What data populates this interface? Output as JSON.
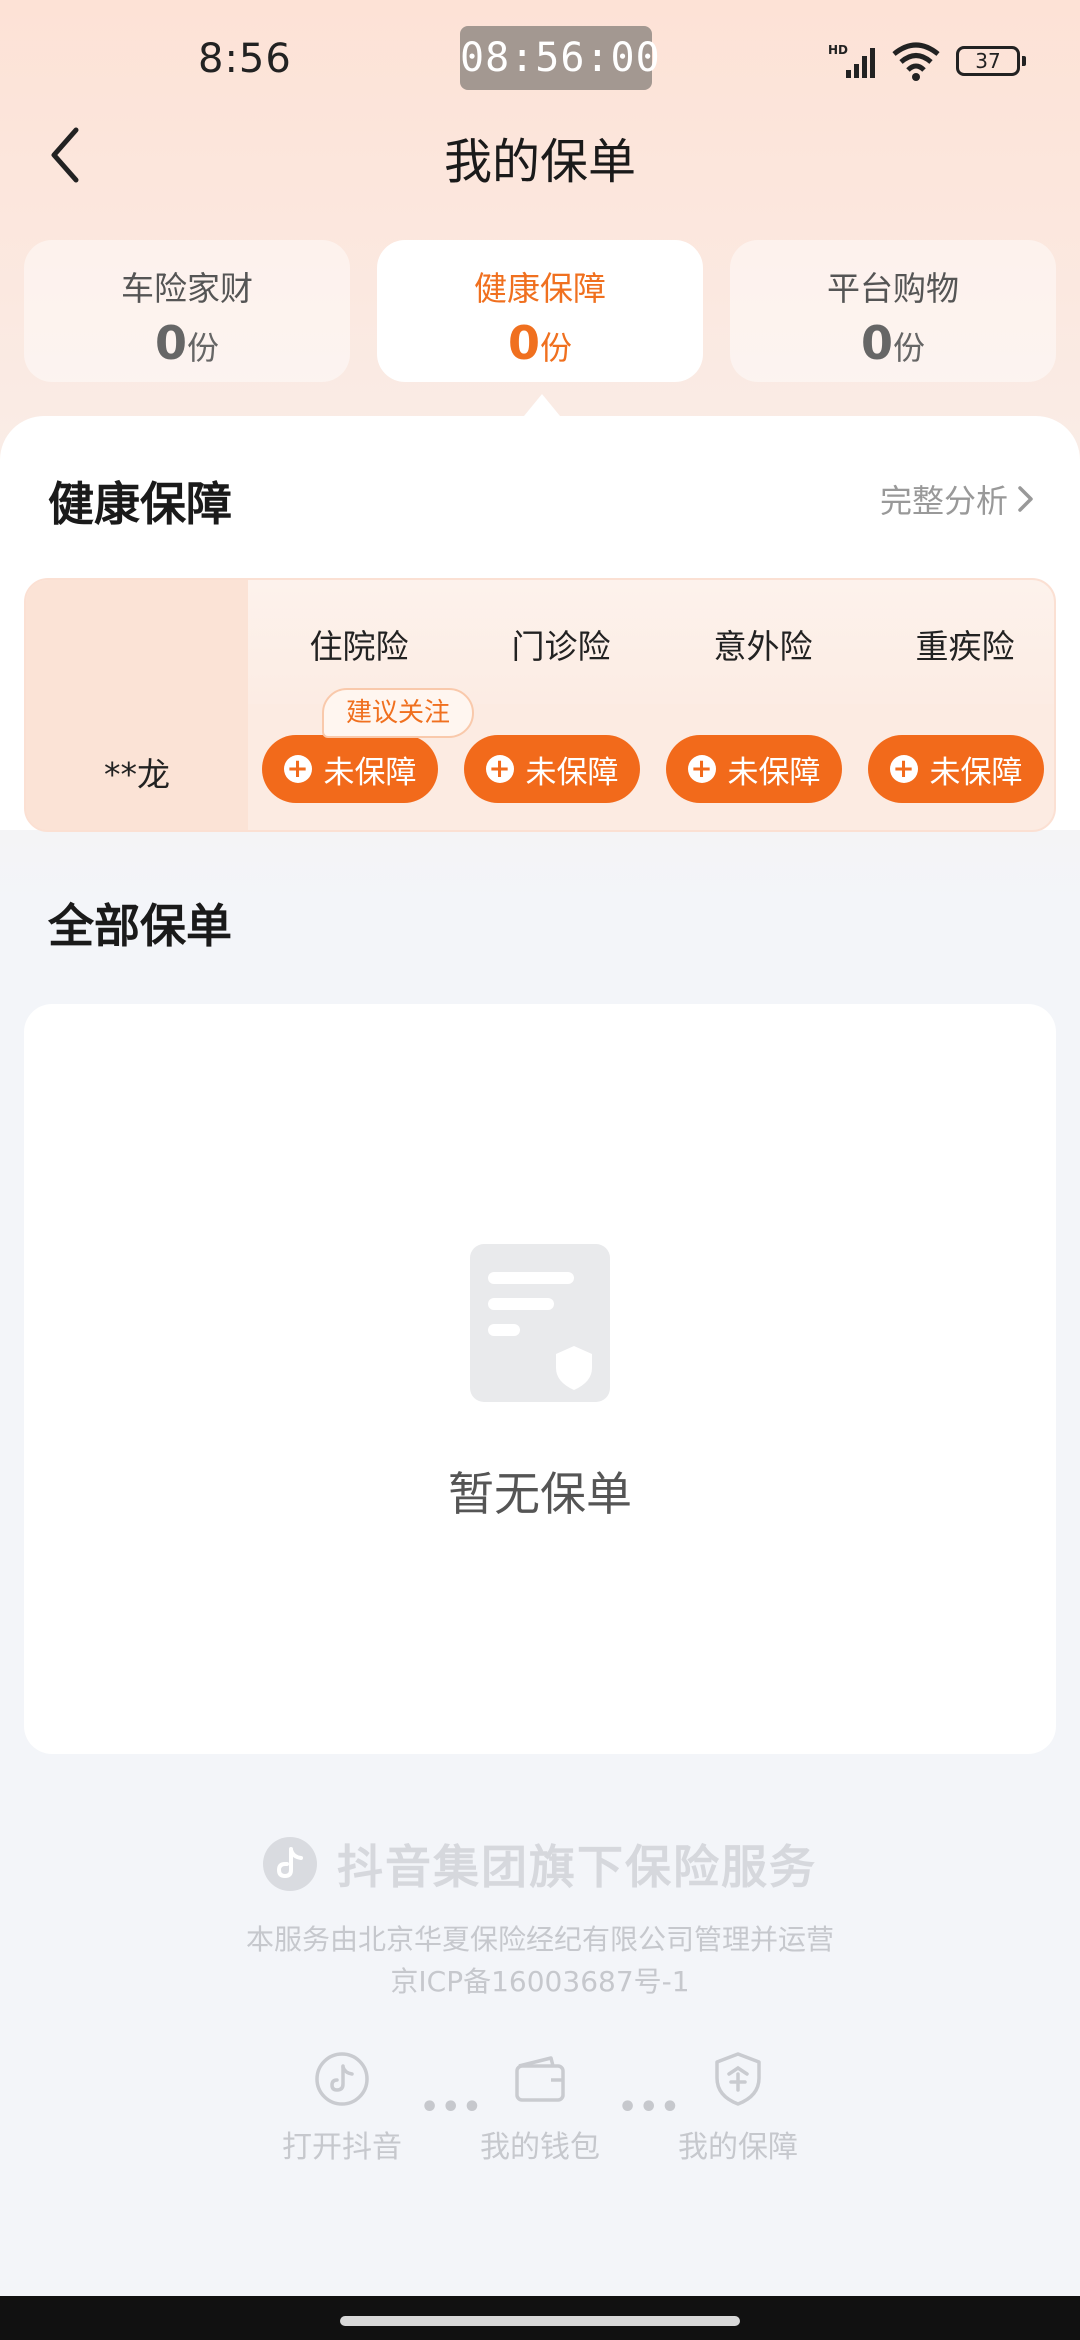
{
  "status_bar": {
    "time": "8:56",
    "clock_overlay": "08:56:00",
    "network": "HD",
    "battery": "37"
  },
  "nav": {
    "title": "我的保单"
  },
  "tabs": [
    {
      "label": "车险家财",
      "count": "0",
      "unit": "份"
    },
    {
      "label": "健康保障",
      "count": "0",
      "unit": "份"
    },
    {
      "label": "平台购物",
      "count": "0",
      "unit": "份"
    }
  ],
  "health": {
    "title": "健康保障",
    "analysis_link": "完整分析",
    "columns": [
      "住院险",
      "门诊险",
      "意外险",
      "重疾险"
    ],
    "member": "**龙",
    "status_label": "未保障",
    "recommend_tag": "建议关注"
  },
  "all_policies": {
    "title": "全部保单",
    "empty_text": "暂无保单"
  },
  "footer": {
    "brand": "抖音集团旗下保险服务",
    "line1": "本服务由北京华夏保险经纪有限公司管理并运营",
    "line2": "京ICP备16003687号-1",
    "links": [
      "打开抖音",
      "我的钱包",
      "我的保障"
    ],
    "dots": "•••"
  },
  "colors": {
    "accent": "#f26a1b",
    "accent_text": "#f0701f"
  }
}
